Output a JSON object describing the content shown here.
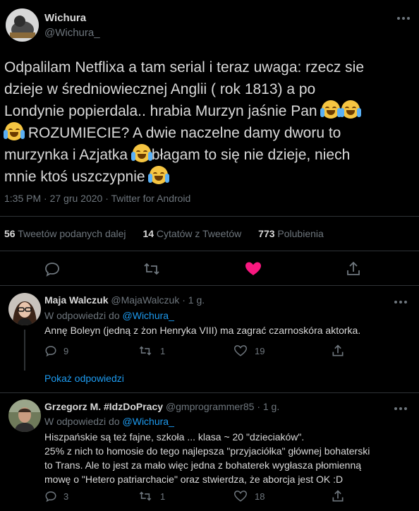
{
  "main_tweet": {
    "display_name": "Wichura",
    "handle": "@Wichura_",
    "text_lines": [
      "Odpalilam Netflixa a tam serial i teraz uwaga: rzecz sie",
      "dzieje w średniowiecznej Anglii ( rok 1813) a po",
      "Londynie popierdala.. hrabia Murzyn jaśnie Pan",
      "ROZUMIECIE? A dwie naczelne damy dworu to",
      "murzynka i Azjatka",
      "błagam to się nie dzieje, niech",
      "mnie ktoś uszczypnie"
    ],
    "timestamp": "1:35 PM · 27 gru 2020 · Twitter for Android",
    "stats": {
      "retweets_count": "56",
      "retweets_label": "Tweetów podanych dalej",
      "quotes_count": "14",
      "quotes_label": "Cytatów z Tweetów",
      "likes_count": "773",
      "likes_label": "Polubienia"
    }
  },
  "replies": [
    {
      "display_name": "Maja Walczuk",
      "handle": "@MajaWalczuk",
      "time": "· 1 g.",
      "reply_to_prefix": "W odpowiedzi do",
      "reply_to_handle": "@Wichura_",
      "text_lines": [
        "Annę Boleyn (jedną z żon Henryka VIII) ma zagrać czarnoskóra aktorka."
      ],
      "reply_count": "9",
      "retweet_count": "1",
      "like_count": "19"
    },
    {
      "display_name": "Grzegorz M. #IdzDoPracy",
      "handle": "@gmprogrammer85",
      "time": "· 1 g.",
      "reply_to_prefix": "W odpowiedzi do",
      "reply_to_handle": "@Wichura_",
      "text_lines": [
        "Hiszpańskie są też fajne, szkoła ... klasa ~ 20 \"dzieciaków\".",
        "25% z nich to homosie do tego najlepsza \"przyjaciółka\" głównej bohaterski",
        "to Trans. Ale to jest za mało więc jedna z bohaterek wygłasza płomienną",
        "mowę o \"Hetero patriarchacie\" oraz stwierdza, że aborcja jest OK :D"
      ],
      "reply_count": "3",
      "retweet_count": "1",
      "like_count": "18"
    }
  ],
  "show_replies_label": "Pokaż odpowiedzi",
  "colors": {
    "accent": "#1d9bf0",
    "like": "#f91880",
    "background": "#000000",
    "muted": "#6e767d"
  },
  "icons": [
    "more-icon",
    "reply-icon",
    "retweet-icon",
    "like-icon",
    "share-icon"
  ]
}
